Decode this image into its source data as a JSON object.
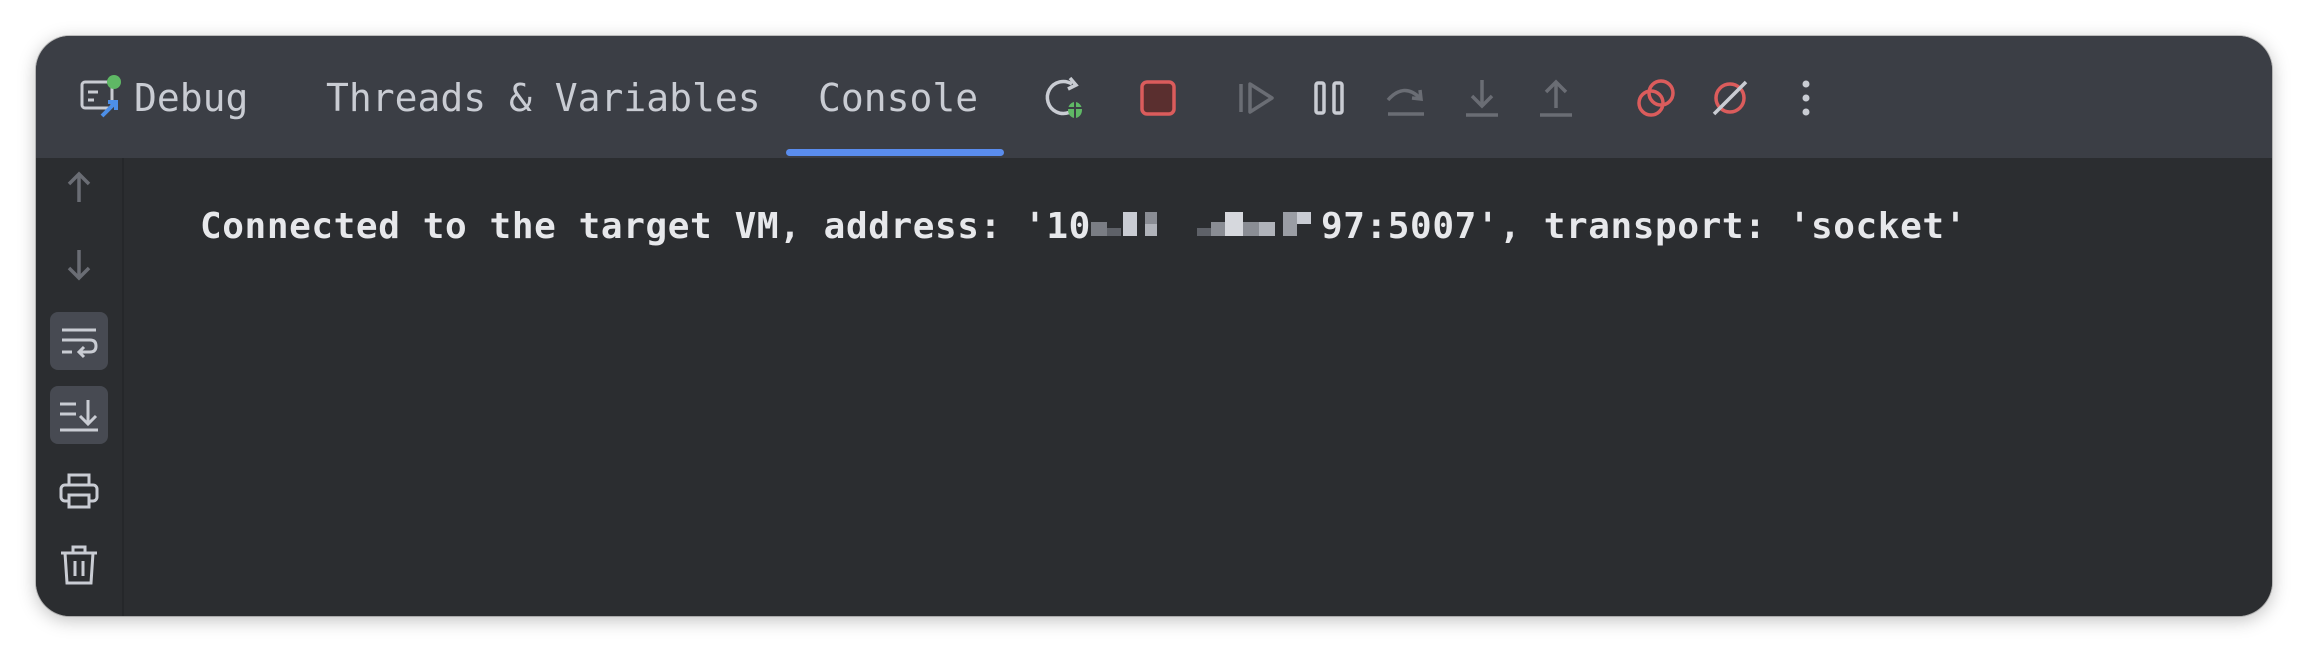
{
  "toolbar": {
    "title": "Debug",
    "tabs": [
      {
        "label": "Threads & Variables",
        "active": false
      },
      {
        "label": "Console",
        "active": true
      }
    ],
    "actions": [
      {
        "icon": "rerun-debug-icon"
      },
      {
        "icon": "stop-icon"
      },
      {
        "icon": "resume-icon"
      },
      {
        "icon": "pause-icon"
      },
      {
        "icon": "step-over-icon"
      },
      {
        "icon": "step-into-icon"
      },
      {
        "icon": "step-out-icon"
      },
      {
        "icon": "view-breakpoints-icon"
      },
      {
        "icon": "mute-breakpoints-icon"
      },
      {
        "icon": "more-vertical-icon"
      }
    ]
  },
  "sidebar": {
    "items": [
      {
        "icon": "arrow-up-icon"
      },
      {
        "icon": "arrow-down-icon"
      },
      {
        "icon": "soft-wrap-icon"
      },
      {
        "icon": "scroll-to-end-icon"
      },
      {
        "icon": "print-icon"
      },
      {
        "icon": "trash-icon"
      }
    ]
  },
  "console": {
    "line_prefix": "Connected to the target VM, address: '10",
    "line_mid": "97:5007', transport: 'socket'"
  },
  "colors": {
    "toolbar_bg": "#3b3e45",
    "console_bg": "#2b2d30",
    "tab_underline": "#5a8dee",
    "stop_red": "#db5c5c",
    "debug_green": "#5fb865"
  }
}
